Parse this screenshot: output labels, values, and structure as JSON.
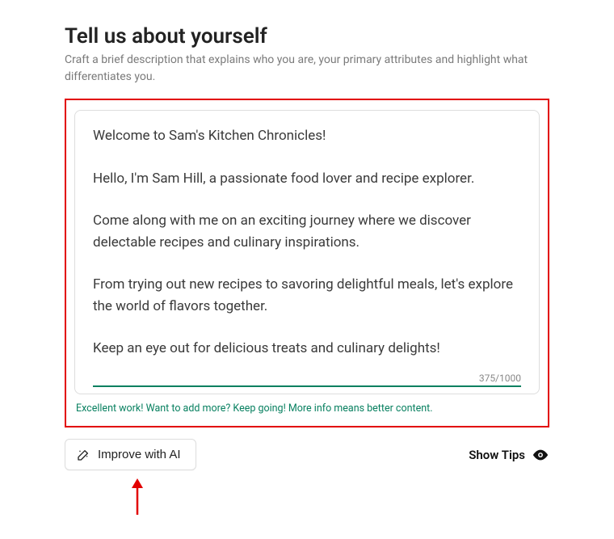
{
  "header": {
    "title": "Tell us about yourself",
    "subtitle": "Craft a brief description that explains who you are, your primary attributes and highlight what differentiates you."
  },
  "bio": {
    "text": "Welcome to Sam's Kitchen Chronicles!\n\nHello, I'm Sam Hill, a passionate food lover and recipe explorer.\n\nCome along with me on an exciting journey where we discover delectable recipes and culinary inspirations.\n\nFrom trying out new recipes to savoring delightful meals, let's explore the world of flavors together.\n\nKeep an eye out for delicious treats and culinary delights!",
    "counter": "375/1000",
    "hint": "Excellent work! Want to add more? Keep going! More info means better content."
  },
  "actions": {
    "improve_label": "Improve with AI",
    "tips_label": "Show Tips"
  },
  "colors": {
    "accent_green": "#088060",
    "highlight_red": "#e20000"
  }
}
